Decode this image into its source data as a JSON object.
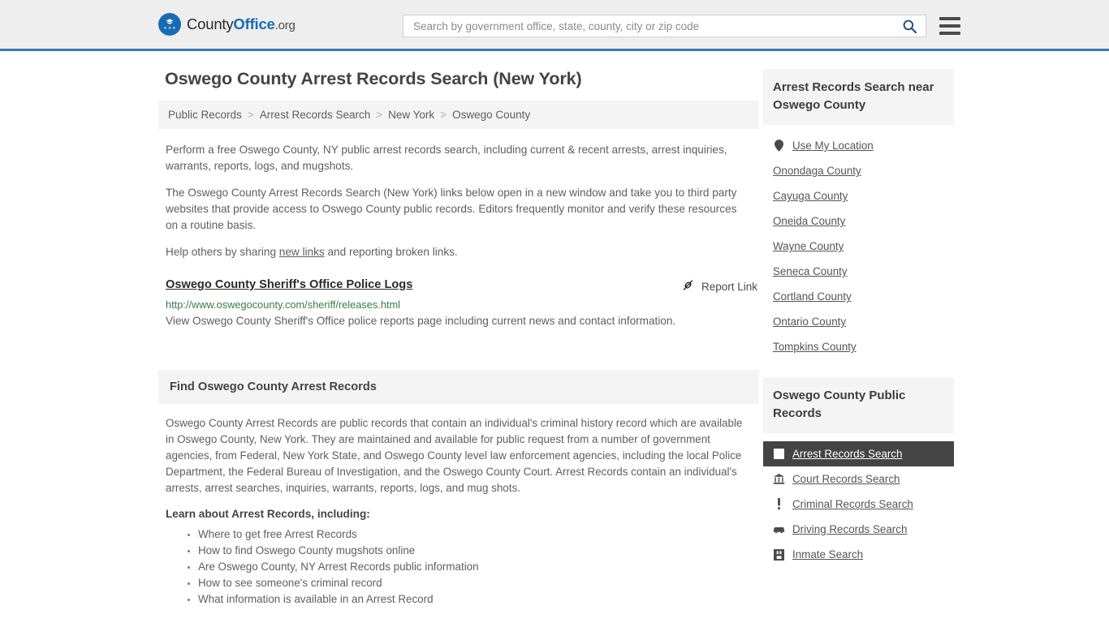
{
  "header": {
    "logo_text_1": "County",
    "logo_text_2": "Office",
    "logo_text_3": ".org",
    "logo_icon": "eagle-seal-icon",
    "search_placeholder": "Search by government office, state, county, city or zip code",
    "search_value": "",
    "search_icon": "search-icon",
    "menu_icon": "hamburger-menu-icon",
    "accent_color": "#3b7ab0"
  },
  "main": {
    "title": "Oswego County Arrest Records Search (New York)",
    "breadcrumb": {
      "items": [
        "Public Records",
        "Arrest Records Search",
        "New York",
        "Oswego County"
      ],
      "separator": ">"
    },
    "paragraphs": [
      "Perform a free Oswego County, NY public arrest records search, including current & recent arrests, arrest inquiries, warrants, reports, logs, and mugshots.",
      "The Oswego County Arrest Records Search (New York) links below open in a new window and take you to third party websites that provide access to Oswego County public records. Editors frequently monitor and verify these resources on a routine basis."
    ],
    "help_prefix": "Help others by sharing ",
    "help_link": "new links",
    "help_suffix": " and reporting broken links.",
    "result": {
      "title": "Oswego County Sheriff's Office Police Logs",
      "url": "http://www.oswegocounty.com/sheriff/releases.html",
      "description": "View Oswego County Sheriff's Office police reports page including current news and contact information.",
      "report_label": "Report Link",
      "report_icon": "broken-link-icon",
      "url_color": "#3a7d44"
    },
    "section": {
      "heading": "Find Oswego County Arrest Records",
      "paragraph": "Oswego County Arrest Records are public records that contain an individual's criminal history record which are available in Oswego County, New York. They are maintained and available for public request from a number of government agencies, from Federal, New York State, and Oswego County level law enforcement agencies, including the local Police Department, the Federal Bureau of Investigation, and the Oswego County Court. Arrest Records contain an individual's arrests, arrest searches, inquiries, warrants, reports, logs, and mug shots.",
      "learn_heading": "Learn about Arrest Records, including:",
      "learn_items": [
        "Where to get free Arrest Records",
        "How to find Oswego County mugshots online",
        "Are Oswego County, NY Arrest Records public information",
        "How to see someone's criminal record",
        "What information is available in an Arrest Record"
      ]
    }
  },
  "sidebar": {
    "nearby": {
      "heading": "Arrest Records Search near Oswego County",
      "items": [
        {
          "label": "Use My Location",
          "icon": "map-pin-icon"
        },
        {
          "label": "Onondaga County",
          "icon": ""
        },
        {
          "label": "Cayuga County",
          "icon": ""
        },
        {
          "label": "Oneida County",
          "icon": ""
        },
        {
          "label": "Wayne County",
          "icon": ""
        },
        {
          "label": "Seneca County",
          "icon": ""
        },
        {
          "label": "Cortland County",
          "icon": ""
        },
        {
          "label": "Ontario County",
          "icon": ""
        },
        {
          "label": "Tompkins County",
          "icon": ""
        }
      ]
    },
    "public_records": {
      "heading": "Oswego County Public Records",
      "active_background": "#444444",
      "items": [
        {
          "label": "Arrest Records Search",
          "icon": "square-icon",
          "active": true
        },
        {
          "label": "Court Records Search",
          "icon": "courthouse-icon",
          "active": false
        },
        {
          "label": "Criminal Records Search",
          "icon": "exclamation-icon",
          "active": false
        },
        {
          "label": "Driving Records Search",
          "icon": "car-icon",
          "active": false
        },
        {
          "label": "Inmate Search",
          "icon": "jail-icon",
          "active": false
        }
      ]
    }
  }
}
